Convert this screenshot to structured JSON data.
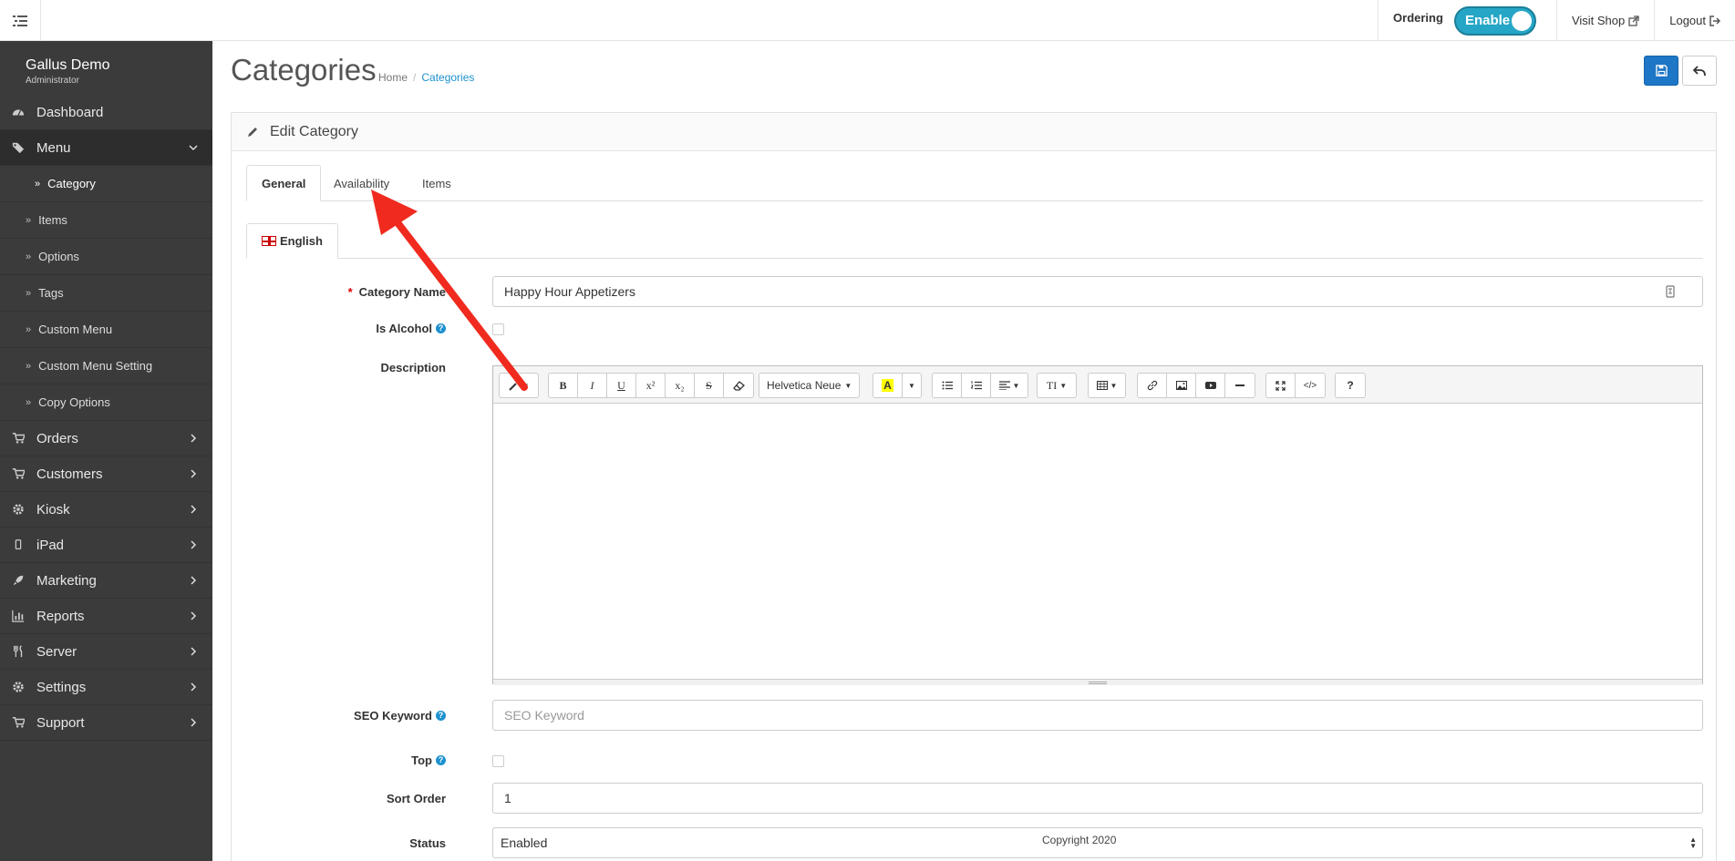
{
  "topbar": {
    "ordering_label": "Ordering",
    "toggle_label": "Enable",
    "visit_shop": "Visit Shop",
    "logout": "Logout"
  },
  "sidebar": {
    "brand_name": "Gallus Demo",
    "brand_role": "Administrator",
    "items": [
      {
        "label": "Dashboard",
        "icon": "dashboard-icon"
      },
      {
        "label": "Menu",
        "icon": "tags-icon"
      },
      {
        "label": "Orders",
        "icon": "cart-icon"
      },
      {
        "label": "Customers",
        "icon": "cart-icon"
      },
      {
        "label": "Kiosk",
        "icon": "gear-icon"
      },
      {
        "label": "iPad",
        "icon": "tablet-icon"
      },
      {
        "label": "Marketing",
        "icon": "rocket-icon"
      },
      {
        "label": "Reports",
        "icon": "bar-chart-icon"
      },
      {
        "label": "Server",
        "icon": "cutlery-icon"
      },
      {
        "label": "Settings",
        "icon": "gear-icon"
      },
      {
        "label": "Support",
        "icon": "cart-icon"
      }
    ],
    "submenu": [
      {
        "label": "Category"
      },
      {
        "label": "Items"
      },
      {
        "label": "Options"
      },
      {
        "label": "Tags"
      },
      {
        "label": "Custom Menu"
      },
      {
        "label": "Custom Menu Setting"
      },
      {
        "label": "Copy Options"
      }
    ]
  },
  "header": {
    "title": "Categories",
    "breadcrumb": [
      "Home",
      "Categories"
    ]
  },
  "panel": {
    "title": "Edit Category",
    "tabs": [
      "General",
      "Availability",
      "Items"
    ],
    "lang_tab": "English"
  },
  "form": {
    "category_name_label": "Category Name",
    "category_name_value": "Happy Hour Appetizers",
    "is_alcohol_label": "Is Alcohol",
    "description_label": "Description",
    "font_name": "Helvetica Neue",
    "seo_keyword_label": "SEO Keyword",
    "seo_keyword_placeholder": "SEO Keyword",
    "top_label": "Top",
    "sort_order_label": "Sort Order",
    "sort_order_value": "1",
    "status_label": "Status",
    "status_value": "Enabled"
  },
  "footer": {
    "copyright": "Copyright 2020"
  },
  "colors": {
    "sidebar_bg": "#3b3b3b",
    "accent": "#1e91cf",
    "toggle": "#26a6c6",
    "save_button": "#1e76c6",
    "annotation_arrow": "#f02a1e"
  }
}
